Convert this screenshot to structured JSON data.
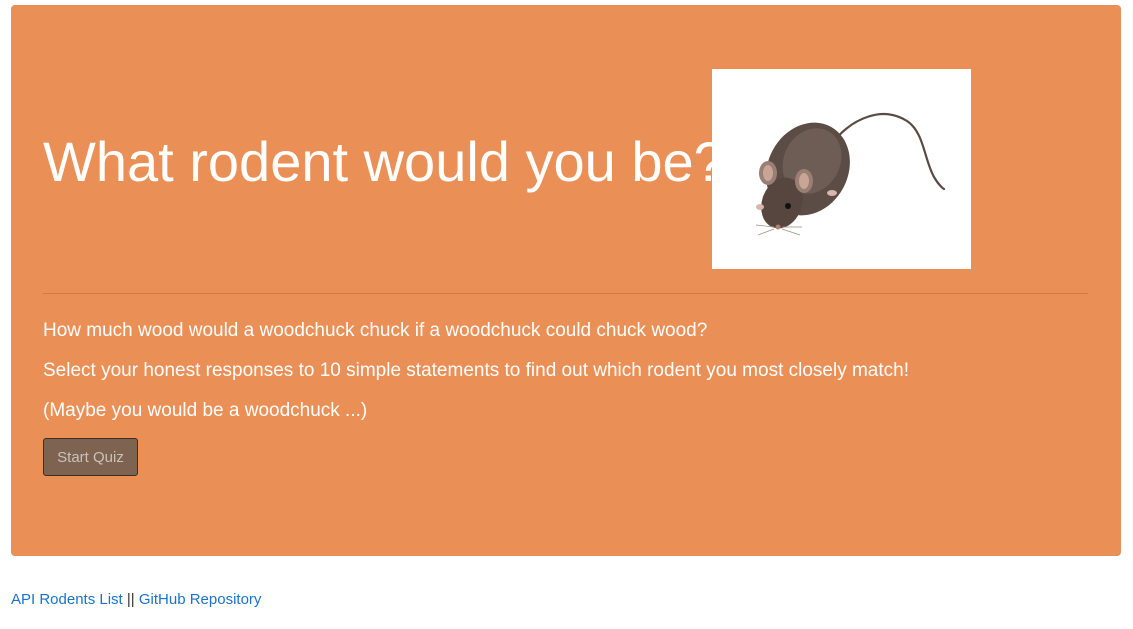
{
  "hero": {
    "title": "What rodent would you be?",
    "image_alt": "mouse-photo",
    "lead_1": "How much wood would a woodchuck chuck if a woodchuck could chuck wood?",
    "lead_2": "Select your honest responses to 10 simple statements to find out which rodent you most closely match!",
    "lead_3": "(Maybe you would be a woodchuck ...)",
    "start_button_label": "Start Quiz"
  },
  "footer": {
    "links": [
      {
        "label": "API Rodents List"
      },
      {
        "label": "GitHub Repository"
      }
    ],
    "separator": "||"
  },
  "colors": {
    "jumbotron_bg": "#ea8f56",
    "button_bg": "#7d6350",
    "link": "#1a73c8"
  }
}
